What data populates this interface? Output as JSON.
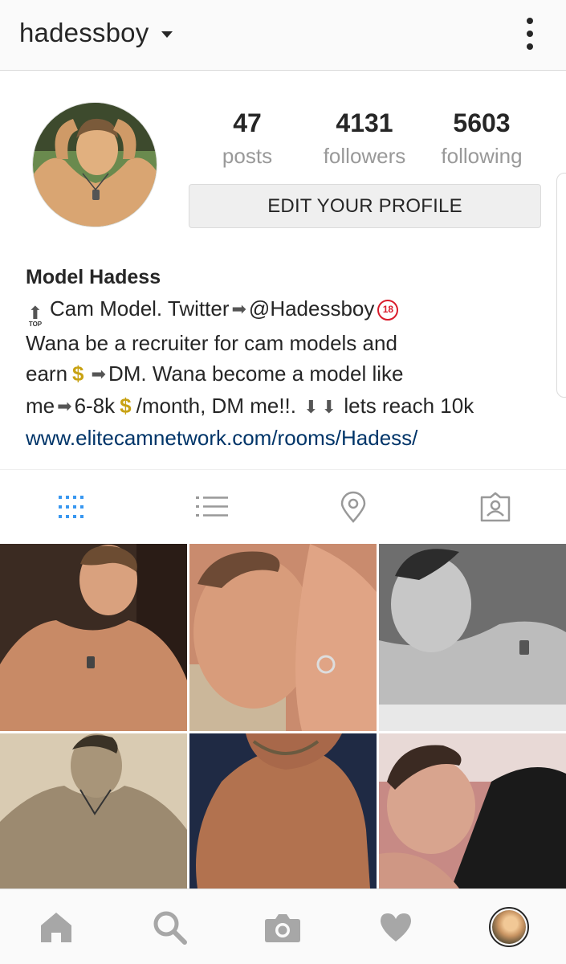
{
  "header": {
    "username": "hadessboy"
  },
  "profile": {
    "stats": [
      {
        "value": "47",
        "label": "posts"
      },
      {
        "value": "4131",
        "label": "followers"
      },
      {
        "value": "5603",
        "label": "following"
      }
    ],
    "edit_button_label": "EDIT YOUR PROFILE",
    "name": "Model Hadess",
    "bio": {
      "line1_text": "Cam Model. Twitter",
      "line1_handle": "@Hadessboy",
      "line1_badge": "18",
      "top_icon_text": "TOP",
      "line2": "Wana be a recruiter for cam models and",
      "line3_a": "earn",
      "line3_b": "DM. Wana become a model like",
      "line4_a": "me",
      "line4_b": "6-8k",
      "line4_c": "/month, DM me!!.",
      "line4_d": "lets reach 10k",
      "dollar": "$",
      "link": "www.elitecamnetwork.com/rooms/Hadess/"
    }
  },
  "tabs": [
    {
      "icon": "grid-icon",
      "active": true
    },
    {
      "icon": "list-icon",
      "active": false
    },
    {
      "icon": "location-pin-icon",
      "active": false
    },
    {
      "icon": "tagged-user-icon",
      "active": false
    }
  ],
  "bottom_nav": [
    "home-icon",
    "search-icon",
    "camera-icon",
    "heart-icon",
    "profile-avatar"
  ],
  "colors": {
    "accent": "#3897f0",
    "link": "#003569",
    "secondary_text": "#999999",
    "badge_red": "#d91b2b",
    "dollar_gold": "#c8a213"
  }
}
